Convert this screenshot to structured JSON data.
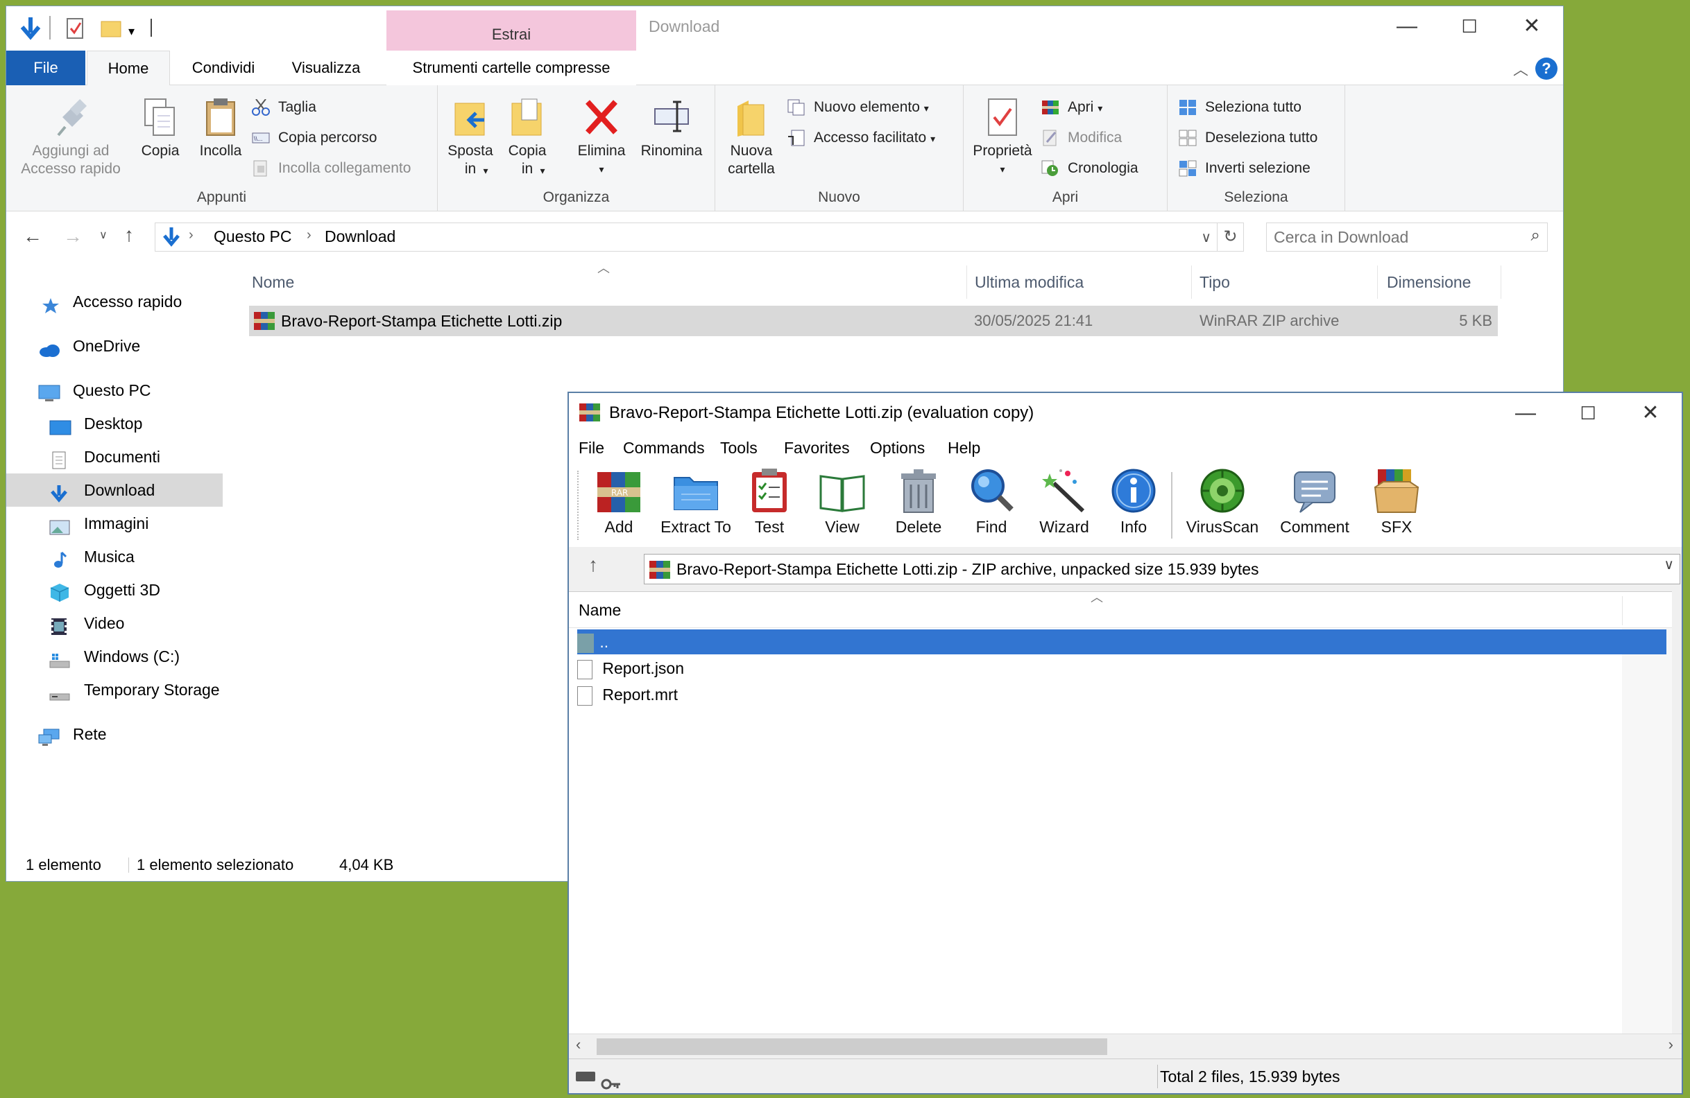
{
  "explorer": {
    "title": "Download",
    "context_tab": "Estrai",
    "context_subtab": "Strumenti cartelle compresse",
    "tabs": [
      "File",
      "Home",
      "Condividi",
      "Visualizza"
    ],
    "ribbon": {
      "appunti": {
        "label": "Appunti",
        "pin": "Aggiungi ad\nAccesso rapido",
        "copy": "Copia",
        "paste": "Incolla",
        "cut": "Taglia",
        "copy_path": "Copia percorso",
        "paste_link": "Incolla collegamento"
      },
      "organizza": {
        "label": "Organizza",
        "move": "Sposta\nin",
        "copyto": "Copia\nin",
        "delete": "Elimina",
        "rename": "Rinomina"
      },
      "nuovo": {
        "label": "Nuovo",
        "new_folder": "Nuova\ncartella",
        "new_item": "Nuovo elemento",
        "easy_access": "Accesso facilitato"
      },
      "apri": {
        "label": "Apri",
        "properties": "Proprietà",
        "open": "Apri",
        "edit": "Modifica",
        "history": "Cronologia"
      },
      "seleziona": {
        "label": "Seleziona",
        "select_all": "Seleziona tutto",
        "select_none": "Deseleziona tutto",
        "invert": "Inverti selezione"
      }
    },
    "address": {
      "crumbs": [
        "Questo PC",
        "Download"
      ],
      "search_placeholder": "Cerca in Download"
    },
    "nav": [
      "Accesso rapido",
      "OneDrive",
      "Questo PC",
      "Desktop",
      "Documenti",
      "Download",
      "Immagini",
      "Musica",
      "Oggetti 3D",
      "Video",
      "Windows (C:)",
      "Temporary Storage",
      "Rete"
    ],
    "columns": [
      "Nome",
      "Ultima modifica",
      "Tipo",
      "Dimensione"
    ],
    "file": {
      "name": "Bravo-Report-Stampa Etichette Lotti.zip",
      "modified": "30/05/2025 21:41",
      "type": "WinRAR ZIP archive",
      "size": "5 KB"
    },
    "status": {
      "count": "1 elemento",
      "selected": "1 elemento selezionato",
      "size": "4,04 KB"
    }
  },
  "winrar": {
    "title": "Bravo-Report-Stampa Etichette Lotti.zip (evaluation copy)",
    "menu": [
      "File",
      "Commands",
      "Tools",
      "Favorites",
      "Options",
      "Help"
    ],
    "toolbar": [
      "Add",
      "Extract To",
      "Test",
      "View",
      "Delete",
      "Find",
      "Wizard",
      "Info",
      "VirusScan",
      "Comment",
      "SFX"
    ],
    "path": "Bravo-Report-Stampa Etichette Lotti.zip - ZIP archive, unpacked size 15.939 bytes",
    "column": "Name",
    "rows": [
      "..",
      "Report.json",
      "Report.mrt"
    ],
    "status": "Total 2 files, 15.939 bytes"
  },
  "colors": {
    "accent": "#1a5fb4",
    "selection": "#3275d1",
    "context_tab": "#f4c6dc",
    "desktop": "#86a93a"
  }
}
